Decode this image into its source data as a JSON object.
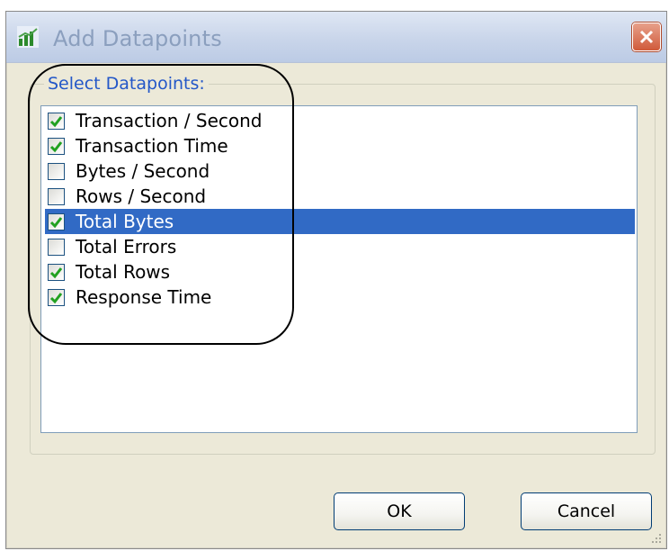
{
  "dialog": {
    "title": "Add Datapoints",
    "close_icon": "close-icon",
    "app_icon": "chart-icon"
  },
  "group": {
    "label": "Select Datapoints:"
  },
  "datapoints": [
    {
      "label": "Transaction / Second",
      "checked": true,
      "selected": false
    },
    {
      "label": "Transaction Time",
      "checked": true,
      "selected": false
    },
    {
      "label": "Bytes / Second",
      "checked": false,
      "selected": false
    },
    {
      "label": "Rows / Second",
      "checked": false,
      "selected": false
    },
    {
      "label": "Total Bytes",
      "checked": true,
      "selected": true
    },
    {
      "label": "Total Errors",
      "checked": false,
      "selected": false
    },
    {
      "label": "Total Rows",
      "checked": true,
      "selected": false
    },
    {
      "label": "Response Time",
      "checked": true,
      "selected": false
    }
  ],
  "buttons": {
    "ok_label": "OK",
    "cancel_label": "Cancel"
  },
  "colors": {
    "selection": "#316ac5",
    "checkmark": "#21a121",
    "group_label": "#2357c8"
  }
}
